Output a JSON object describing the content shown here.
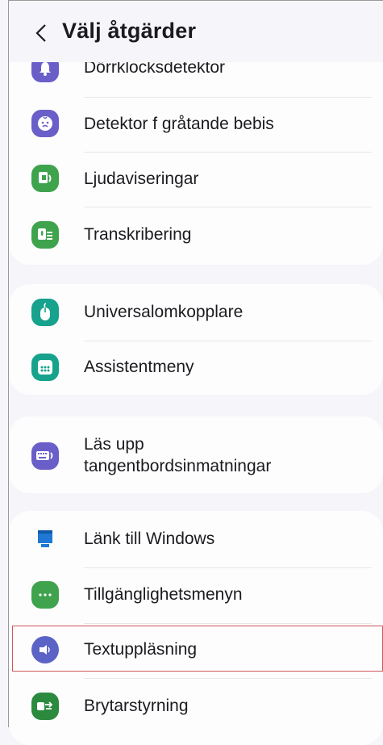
{
  "header": {
    "title": "Välj åtgärder"
  },
  "groups": [
    {
      "items": [
        {
          "label": "Dörrklocksdetektor",
          "icon": "bell-icon",
          "color": "#6a5fc9"
        },
        {
          "label": "Detektor f gråtande bebis",
          "icon": "crying-baby-icon",
          "color": "#6a5fc9"
        },
        {
          "label": "Ljudaviseringar",
          "icon": "sound-notification-icon",
          "color": "#3fa34d"
        },
        {
          "label": "Transkribering",
          "icon": "transcribe-icon",
          "color": "#3fa34d"
        }
      ]
    },
    {
      "items": [
        {
          "label": "Universalomkopplare",
          "icon": "mouse-icon",
          "color": "#16a28c"
        },
        {
          "label": "Assistentmeny",
          "icon": "assistant-menu-icon",
          "color": "#16a28c"
        }
      ]
    },
    {
      "items": [
        {
          "label_line1": "Läs upp",
          "label_line2": "tangentbordsinmatningar",
          "icon": "keyboard-speak-icon",
          "color": "#6a5fc9"
        }
      ]
    },
    {
      "items": [
        {
          "label": "Länk till Windows",
          "icon": "link-to-windows-icon",
          "color": "#1e78d4"
        },
        {
          "label": "Tillgänglighetsmenyn",
          "icon": "accessibility-menu-icon",
          "color": "#3fa34d"
        },
        {
          "label": "Textuppläsning",
          "icon": "text-to-speech-icon",
          "color": "#5c63c7",
          "selected": true
        },
        {
          "label": "Brytarstyrning",
          "icon": "switch-control-icon",
          "color": "#2b8a3e"
        }
      ]
    }
  ]
}
